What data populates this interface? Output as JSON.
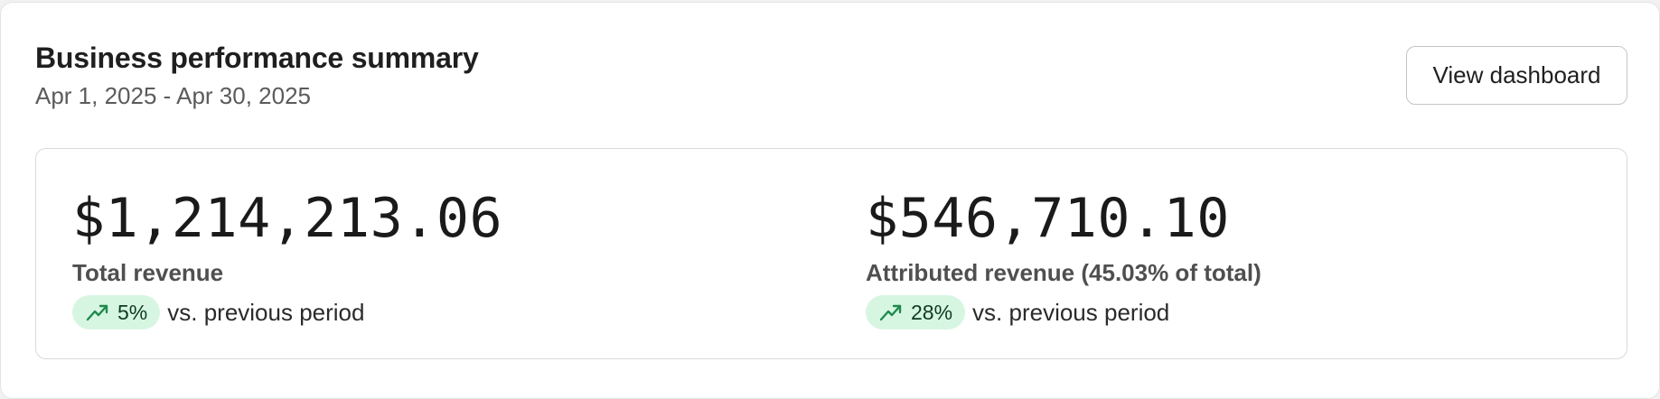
{
  "header": {
    "title": "Business performance summary",
    "date_range": "Apr 1, 2025 - Apr 30, 2025",
    "view_button_label": "View dashboard"
  },
  "metrics": [
    {
      "value": "$1,214,213.06",
      "label": "Total revenue",
      "change": "5%",
      "change_direction": "up",
      "comparison_text": "vs. previous period",
      "icon": "trend-up-icon"
    },
    {
      "value": "$546,710.10",
      "label": "Attributed revenue (45.03% of total)",
      "change": "28%",
      "change_direction": "up",
      "comparison_text": "vs. previous period",
      "icon": "trend-up-icon"
    }
  ],
  "colors": {
    "positive_pill_bg": "#d7f6e2",
    "positive_icon": "#1f8a4c"
  }
}
